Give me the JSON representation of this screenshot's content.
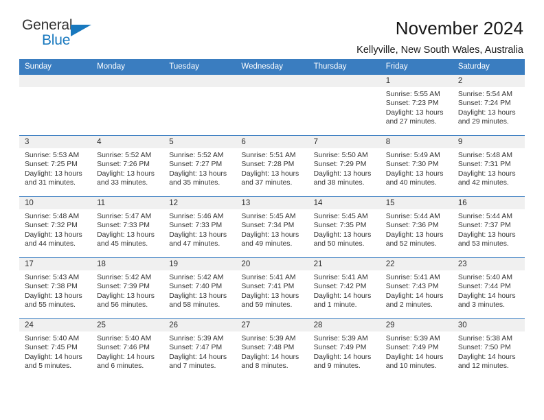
{
  "logo": {
    "line1": "General",
    "line2": "Blue",
    "triangle_icon": "triangle-icon",
    "color_dark": "#333333",
    "color_blue": "#1878be"
  },
  "header": {
    "title": "November 2024",
    "subtitle": "Kellyville, New South Wales, Australia"
  },
  "calendar": {
    "weekday_headers": [
      "Sunday",
      "Monday",
      "Tuesday",
      "Wednesday",
      "Thursday",
      "Friday",
      "Saturday"
    ],
    "header_bg": "#3a7dc0",
    "daynum_bg": "#f0f0f0",
    "weeks": [
      [
        {
          "day": "",
          "sunrise": "",
          "sunset": "",
          "daylight": "",
          "empty": true
        },
        {
          "day": "",
          "sunrise": "",
          "sunset": "",
          "daylight": "",
          "empty": true
        },
        {
          "day": "",
          "sunrise": "",
          "sunset": "",
          "daylight": "",
          "empty": true
        },
        {
          "day": "",
          "sunrise": "",
          "sunset": "",
          "daylight": "",
          "empty": true
        },
        {
          "day": "",
          "sunrise": "",
          "sunset": "",
          "daylight": "",
          "empty": true
        },
        {
          "day": "1",
          "sunrise": "Sunrise: 5:55 AM",
          "sunset": "Sunset: 7:23 PM",
          "daylight": "Daylight: 13 hours and 27 minutes."
        },
        {
          "day": "2",
          "sunrise": "Sunrise: 5:54 AM",
          "sunset": "Sunset: 7:24 PM",
          "daylight": "Daylight: 13 hours and 29 minutes."
        }
      ],
      [
        {
          "day": "3",
          "sunrise": "Sunrise: 5:53 AM",
          "sunset": "Sunset: 7:25 PM",
          "daylight": "Daylight: 13 hours and 31 minutes."
        },
        {
          "day": "4",
          "sunrise": "Sunrise: 5:52 AM",
          "sunset": "Sunset: 7:26 PM",
          "daylight": "Daylight: 13 hours and 33 minutes."
        },
        {
          "day": "5",
          "sunrise": "Sunrise: 5:52 AM",
          "sunset": "Sunset: 7:27 PM",
          "daylight": "Daylight: 13 hours and 35 minutes."
        },
        {
          "day": "6",
          "sunrise": "Sunrise: 5:51 AM",
          "sunset": "Sunset: 7:28 PM",
          "daylight": "Daylight: 13 hours and 37 minutes."
        },
        {
          "day": "7",
          "sunrise": "Sunrise: 5:50 AM",
          "sunset": "Sunset: 7:29 PM",
          "daylight": "Daylight: 13 hours and 38 minutes."
        },
        {
          "day": "8",
          "sunrise": "Sunrise: 5:49 AM",
          "sunset": "Sunset: 7:30 PM",
          "daylight": "Daylight: 13 hours and 40 minutes."
        },
        {
          "day": "9",
          "sunrise": "Sunrise: 5:48 AM",
          "sunset": "Sunset: 7:31 PM",
          "daylight": "Daylight: 13 hours and 42 minutes."
        }
      ],
      [
        {
          "day": "10",
          "sunrise": "Sunrise: 5:48 AM",
          "sunset": "Sunset: 7:32 PM",
          "daylight": "Daylight: 13 hours and 44 minutes."
        },
        {
          "day": "11",
          "sunrise": "Sunrise: 5:47 AM",
          "sunset": "Sunset: 7:33 PM",
          "daylight": "Daylight: 13 hours and 45 minutes."
        },
        {
          "day": "12",
          "sunrise": "Sunrise: 5:46 AM",
          "sunset": "Sunset: 7:33 PM",
          "daylight": "Daylight: 13 hours and 47 minutes."
        },
        {
          "day": "13",
          "sunrise": "Sunrise: 5:45 AM",
          "sunset": "Sunset: 7:34 PM",
          "daylight": "Daylight: 13 hours and 49 minutes."
        },
        {
          "day": "14",
          "sunrise": "Sunrise: 5:45 AM",
          "sunset": "Sunset: 7:35 PM",
          "daylight": "Daylight: 13 hours and 50 minutes."
        },
        {
          "day": "15",
          "sunrise": "Sunrise: 5:44 AM",
          "sunset": "Sunset: 7:36 PM",
          "daylight": "Daylight: 13 hours and 52 minutes."
        },
        {
          "day": "16",
          "sunrise": "Sunrise: 5:44 AM",
          "sunset": "Sunset: 7:37 PM",
          "daylight": "Daylight: 13 hours and 53 minutes."
        }
      ],
      [
        {
          "day": "17",
          "sunrise": "Sunrise: 5:43 AM",
          "sunset": "Sunset: 7:38 PM",
          "daylight": "Daylight: 13 hours and 55 minutes."
        },
        {
          "day": "18",
          "sunrise": "Sunrise: 5:42 AM",
          "sunset": "Sunset: 7:39 PM",
          "daylight": "Daylight: 13 hours and 56 minutes."
        },
        {
          "day": "19",
          "sunrise": "Sunrise: 5:42 AM",
          "sunset": "Sunset: 7:40 PM",
          "daylight": "Daylight: 13 hours and 58 minutes."
        },
        {
          "day": "20",
          "sunrise": "Sunrise: 5:41 AM",
          "sunset": "Sunset: 7:41 PM",
          "daylight": "Daylight: 13 hours and 59 minutes."
        },
        {
          "day": "21",
          "sunrise": "Sunrise: 5:41 AM",
          "sunset": "Sunset: 7:42 PM",
          "daylight": "Daylight: 14 hours and 1 minute."
        },
        {
          "day": "22",
          "sunrise": "Sunrise: 5:41 AM",
          "sunset": "Sunset: 7:43 PM",
          "daylight": "Daylight: 14 hours and 2 minutes."
        },
        {
          "day": "23",
          "sunrise": "Sunrise: 5:40 AM",
          "sunset": "Sunset: 7:44 PM",
          "daylight": "Daylight: 14 hours and 3 minutes."
        }
      ],
      [
        {
          "day": "24",
          "sunrise": "Sunrise: 5:40 AM",
          "sunset": "Sunset: 7:45 PM",
          "daylight": "Daylight: 14 hours and 5 minutes."
        },
        {
          "day": "25",
          "sunrise": "Sunrise: 5:40 AM",
          "sunset": "Sunset: 7:46 PM",
          "daylight": "Daylight: 14 hours and 6 minutes."
        },
        {
          "day": "26",
          "sunrise": "Sunrise: 5:39 AM",
          "sunset": "Sunset: 7:47 PM",
          "daylight": "Daylight: 14 hours and 7 minutes."
        },
        {
          "day": "27",
          "sunrise": "Sunrise: 5:39 AM",
          "sunset": "Sunset: 7:48 PM",
          "daylight": "Daylight: 14 hours and 8 minutes."
        },
        {
          "day": "28",
          "sunrise": "Sunrise: 5:39 AM",
          "sunset": "Sunset: 7:49 PM",
          "daylight": "Daylight: 14 hours and 9 minutes."
        },
        {
          "day": "29",
          "sunrise": "Sunrise: 5:39 AM",
          "sunset": "Sunset: 7:49 PM",
          "daylight": "Daylight: 14 hours and 10 minutes."
        },
        {
          "day": "30",
          "sunrise": "Sunrise: 5:38 AM",
          "sunset": "Sunset: 7:50 PM",
          "daylight": "Daylight: 14 hours and 12 minutes."
        }
      ]
    ]
  }
}
